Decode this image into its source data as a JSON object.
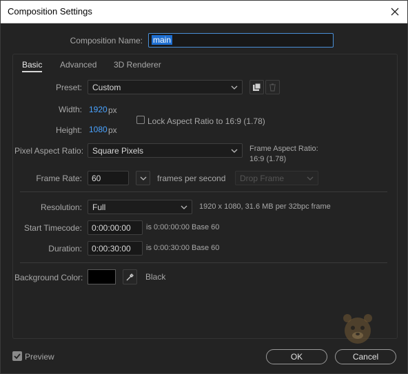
{
  "window": {
    "title": "Composition Settings"
  },
  "comp_name": {
    "label": "Composition Name:",
    "value": "main"
  },
  "tabs": [
    {
      "label": "Basic",
      "active": true
    },
    {
      "label": "Advanced",
      "active": false
    },
    {
      "label": "3D Renderer",
      "active": false
    }
  ],
  "preset": {
    "label": "Preset:",
    "value": "Custom"
  },
  "width": {
    "label": "Width:",
    "value": "1920",
    "unit": "px"
  },
  "height": {
    "label": "Height:",
    "value": "1080",
    "unit": "px"
  },
  "lock_aspect": {
    "label": "Lock Aspect Ratio to 16:9 (1.78)",
    "checked": false
  },
  "pixel_aspect": {
    "label": "Pixel Aspect Ratio:",
    "value": "Square Pixels"
  },
  "frame_aspect": {
    "label": "Frame Aspect Ratio:",
    "value": "16:9 (1.78)"
  },
  "frame_rate": {
    "label": "Frame Rate:",
    "value": "60",
    "unit": "frames per second",
    "drop_frame": "Drop Frame"
  },
  "resolution": {
    "label": "Resolution:",
    "value": "Full",
    "info": "1920 x 1080, 31.6 MB per 32bpc frame"
  },
  "start_timecode": {
    "label": "Start Timecode:",
    "value": "0:00:00:00",
    "is_text": "is 0:00:00:00",
    "base": "Base 60"
  },
  "duration": {
    "label": "Duration:",
    "value": "0:00:30:00",
    "is_text": "is 0:00:30:00",
    "base": "Base 60"
  },
  "background": {
    "label": "Background Color:",
    "color_name": "Black",
    "color": "#000000"
  },
  "preview": {
    "label": "Preview",
    "checked": true
  },
  "buttons": {
    "ok": "OK",
    "cancel": "Cancel"
  },
  "icons": {
    "close": "close-icon",
    "chevron": "chevron-down-icon",
    "save_preset": "save-preset-icon",
    "delete_preset": "trash-icon",
    "eyedropper": "eyedropper-icon",
    "checkmark": "checkmark-icon"
  },
  "colors": {
    "accent": "#4aa3ff",
    "background": "#232323",
    "selection": "#1f6fd1"
  }
}
